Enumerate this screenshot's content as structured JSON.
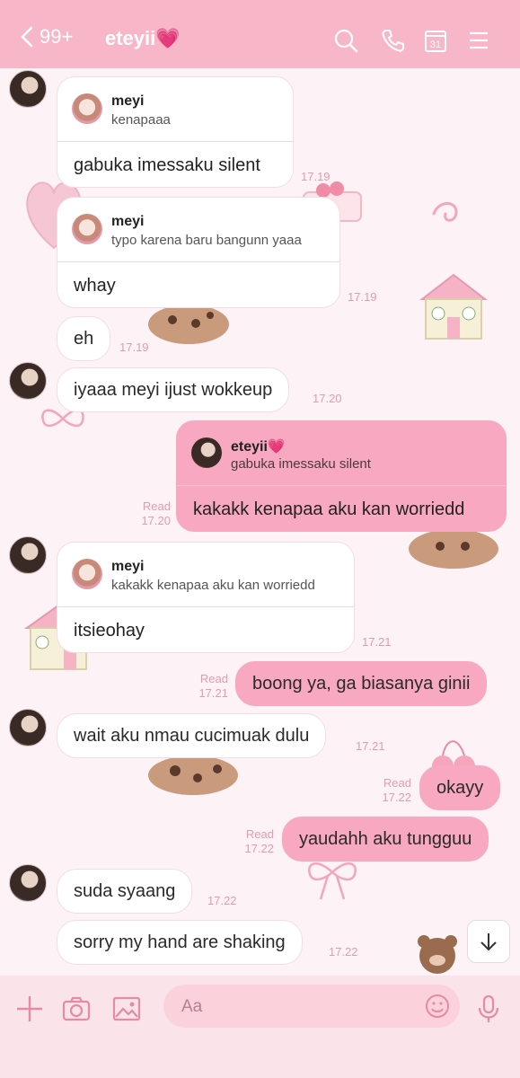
{
  "header": {
    "back_count": "99+",
    "title": "eteyii💗",
    "icons": [
      "search-icon",
      "phone-icon",
      "calendar-icon",
      "menu-icon"
    ],
    "calendar_day": "31"
  },
  "messages": [
    {
      "id": "m1",
      "reply_to": {
        "name": "meyi",
        "quote": "kenapaaa"
      },
      "text": "gabuka imessaku silent",
      "time": "17.19"
    },
    {
      "id": "m2",
      "reply_to": {
        "name": "meyi",
        "quote": "typo karena baru bangunn yaaa"
      },
      "text": "whay",
      "time": "17.19"
    },
    {
      "id": "m3",
      "text": "eh",
      "time": "17.19"
    },
    {
      "id": "m4",
      "text": "iyaaa meyi ijust wokkeup",
      "time": "17.20"
    },
    {
      "id": "m5",
      "mine": true,
      "reply_to": {
        "name": "eteyii💗",
        "quote": "gabuka imessaku silent"
      },
      "text": "kakakk kenapaa aku kan worriedd",
      "read": "Read",
      "time": "17.20"
    },
    {
      "id": "m6",
      "reply_to": {
        "name": "meyi",
        "quote": "kakakk kenapaa aku kan worriedd"
      },
      "text": "itsieohay",
      "time": "17.21"
    },
    {
      "id": "m7",
      "mine": true,
      "text": "boong ya, ga biasanya ginii",
      "read": "Read",
      "time": "17.21"
    },
    {
      "id": "m8",
      "text": "wait aku nmau cucimuak dulu",
      "time": "17.21"
    },
    {
      "id": "m9",
      "mine": true,
      "text": "okayy",
      "read": "Read",
      "time": "17.22"
    },
    {
      "id": "m10",
      "mine": true,
      "text": "yaudahh aku tungguu",
      "read": "Read",
      "time": "17.22"
    },
    {
      "id": "m11",
      "text": "suda syaang",
      "time": "17.22"
    },
    {
      "id": "m12",
      "text": "sorry my hand are shaking",
      "time": "17.22"
    }
  ],
  "footer": {
    "input_placeholder": "Aa",
    "icons": [
      "plus-icon",
      "camera-icon",
      "image-icon",
      "emoji-icon",
      "mic-icon"
    ]
  },
  "colors": {
    "header_bg": "#f7b7c8",
    "mine_bubble": "#f8a8c0",
    "timestamp": "#e59aaf",
    "footer_bg": "#fbe3ea"
  }
}
